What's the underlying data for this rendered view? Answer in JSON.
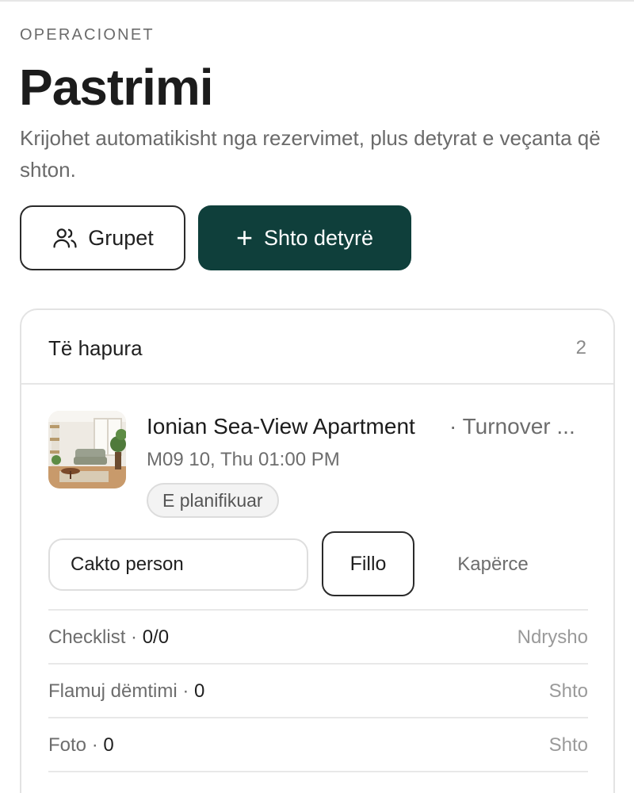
{
  "header": {
    "eyebrow": "OPERACIONET",
    "title": "Pastrimi",
    "subtitle": "Krijohet automatikisht nga rezervimet, plus detyrat e veçanta që shton."
  },
  "actions": {
    "groups_label": "Grupet",
    "groups_icon": "users-icon",
    "add_label": "Shto detyrë",
    "add_icon": "plus-icon"
  },
  "open_section": {
    "title": "Të hapura",
    "count": "2",
    "task": {
      "property": "Ionian Sea-View Apartment",
      "type": "· Turnover ...",
      "datetime": "M09 10, Thu 01:00 PM",
      "status": "E planifikuar",
      "assign_label": "Cakto person",
      "start_label": "Fillo",
      "skip_label": "Kapërce",
      "rows": [
        {
          "label": "Checklist · ",
          "value": "0/0",
          "action": "Ndrysho"
        },
        {
          "label": "Flamuj dëmtimi · ",
          "value": "0",
          "action": "Shto"
        },
        {
          "label": "Foto · ",
          "value": "0",
          "action": "Shto"
        }
      ]
    }
  },
  "colors": {
    "primary": "#0f3f3b",
    "text": "#1f1f1f",
    "muted": "#6d6d6d",
    "border": "#e3e3e3"
  }
}
